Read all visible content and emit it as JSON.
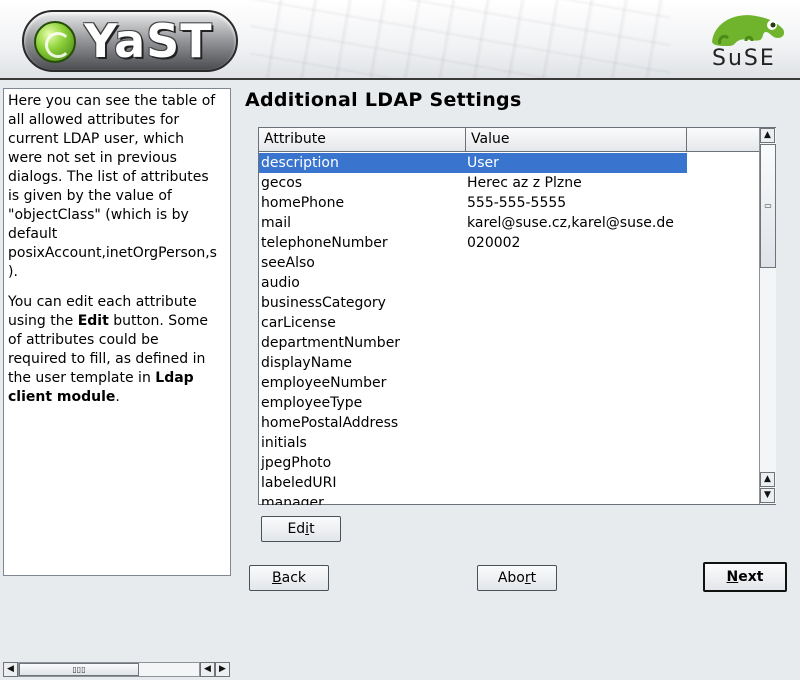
{
  "header": {
    "app_logo_text": "YaST",
    "brand_logo_text": "SuSE"
  },
  "help": {
    "paragraphs": [
      "Here you can see the table of all allowed attributes for current LDAP user, which were not set in previous dialogs. The list of attributes is given by the value of \"objectClass\" (which is by default posixAccount,inetOrgPerson,s).",
      "You can edit each attribute using the Edit button. Some of attributes could be required to fill, as defined in the user template in Ldap client module."
    ],
    "lines_p1": [
      "Here you can see the table of",
      "all allowed attributes for",
      "current LDAP user, which",
      "were not set in previous",
      "dialogs. The list of attributes",
      "is given by the value of",
      "\"objectClass\" (which is by",
      "default",
      "posixAccount,inetOrgPerson,s",
      ")."
    ],
    "p2_line1": "You can edit each attribute",
    "p2_line2_pre": "using the ",
    "p2_line2_bold": "Edit",
    "p2_line2_post": " button. Some",
    "p2_line3": "of attributes could be",
    "p2_line4": "required to fill, as defined in",
    "p2_line5_pre": "the user template in ",
    "p2_line5_bold": "Ldap",
    "p2_line6_bold": "client module",
    "p2_line6_post": "."
  },
  "main": {
    "title": "Additional LDAP Settings",
    "table": {
      "columns": [
        "Attribute",
        "Value"
      ],
      "selected_index": 0,
      "rows": [
        {
          "attribute": "description",
          "value": "User"
        },
        {
          "attribute": "gecos",
          "value": "Herec az z Plzne"
        },
        {
          "attribute": "homePhone",
          "value": "555-555-5555"
        },
        {
          "attribute": "mail",
          "value": "karel@suse.cz,karel@suse.de"
        },
        {
          "attribute": "telephoneNumber",
          "value": "020002"
        },
        {
          "attribute": "seeAlso",
          "value": ""
        },
        {
          "attribute": "audio",
          "value": ""
        },
        {
          "attribute": "businessCategory",
          "value": ""
        },
        {
          "attribute": "carLicense",
          "value": ""
        },
        {
          "attribute": "departmentNumber",
          "value": ""
        },
        {
          "attribute": "displayName",
          "value": ""
        },
        {
          "attribute": "employeeNumber",
          "value": ""
        },
        {
          "attribute": "employeeType",
          "value": ""
        },
        {
          "attribute": "homePostalAddress",
          "value": ""
        },
        {
          "attribute": "initials",
          "value": ""
        },
        {
          "attribute": "jpegPhoto",
          "value": ""
        },
        {
          "attribute": "labeledURI",
          "value": ""
        },
        {
          "attribute": "manager",
          "value": ""
        }
      ]
    },
    "edit_button": {
      "pre": "Ed",
      "u": "i",
      "post": "t"
    }
  },
  "footer": {
    "back_button": {
      "pre": "",
      "u": "B",
      "post": "ack"
    },
    "abort_button": {
      "pre": "Abo",
      "u": "r",
      "post": "t"
    },
    "next_button": {
      "pre": "",
      "u": "N",
      "post": "ext"
    }
  },
  "colors": {
    "selection": "#3974cf",
    "background": "#e8ebee"
  }
}
